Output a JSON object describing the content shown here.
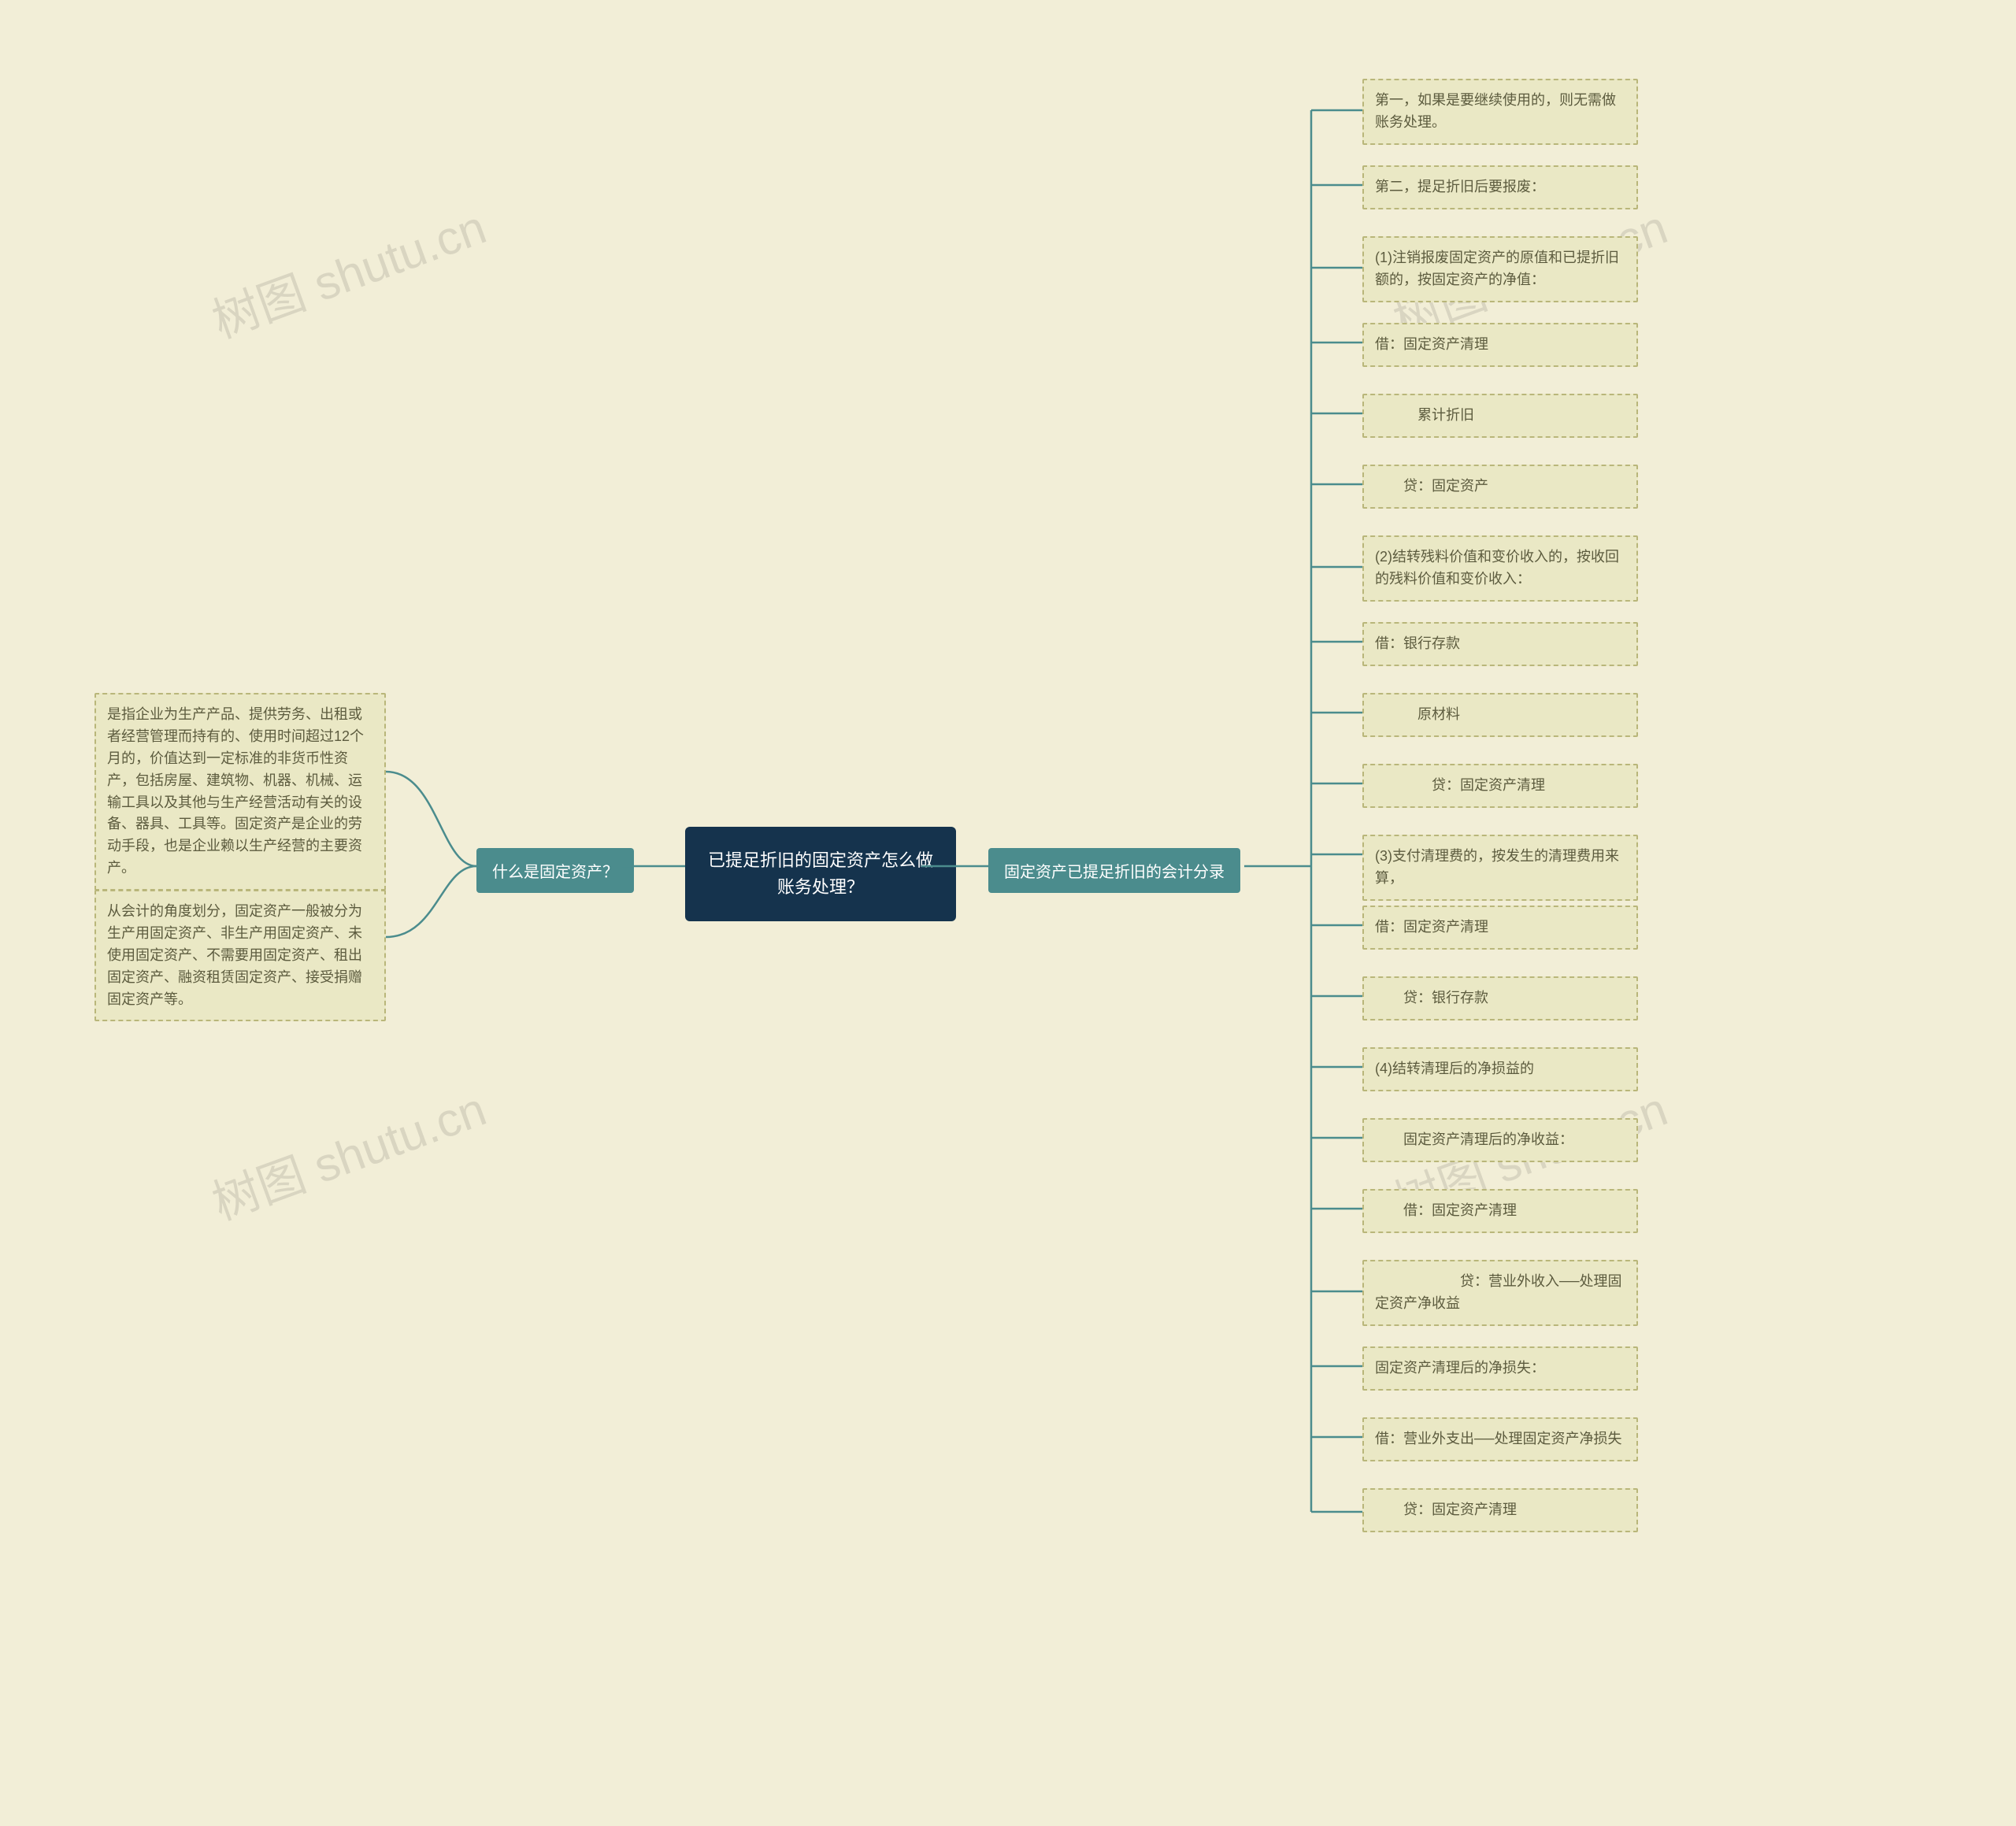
{
  "watermarks": {
    "w1": "树图 shutu.cn",
    "w2": "树图 shutu.cn",
    "w3": "树图 shutu.cn",
    "w4": "树图 shutu.cn"
  },
  "root": {
    "title": "已提足折旧的固定资产怎么做账务处理？"
  },
  "left_branch": {
    "label": "什么是固定资产？",
    "items": [
      "是指企业为生产产品、提供劳务、出租或者经营管理而持有的、使用时间超过12个月的，价值达到一定标准的非货币性资产，包括房屋、建筑物、机器、机械、运输工具以及其他与生产经营活动有关的设备、器具、工具等。固定资产是企业的劳动手段，也是企业赖以生产经营的主要资产。",
      "从会计的角度划分，固定资产一般被分为生产用固定资产、非生产用固定资产、未使用固定资产、不需要用固定资产、租出固定资产、融资租赁固定资产、接受捐赠固定资产等。"
    ]
  },
  "right_branch": {
    "label": "固定资产已提足折旧的会计分录",
    "items": [
      "第一，如果是要继续使用的，则无需做账务处理。",
      "第二，提足折旧后要报废：",
      "(1)注销报废固定资产的原值和已提折旧额的，按固定资产的净值：",
      "借：固定资产清理",
      "　　　累计折旧",
      "　　贷：固定资产",
      "(2)结转残料价值和变价收入的，按收回的残料价值和变价收入：",
      "借：银行存款",
      "　　　原材料",
      "　　　　贷：固定资产清理",
      "(3)支付清理费的，按发生的清理费用来算，",
      "借：固定资产清理",
      "　　贷：银行存款",
      "(4)结转清理后的净损益的",
      "　　固定资产清理后的净收益：",
      "　　借：固定资产清理",
      "　　　　　　贷：营业外收入──处理固定资产净收益",
      "固定资产清理后的净损失：",
      "借：营业外支出──处理固定资产净损失",
      "　　贷：固定资产清理"
    ]
  }
}
